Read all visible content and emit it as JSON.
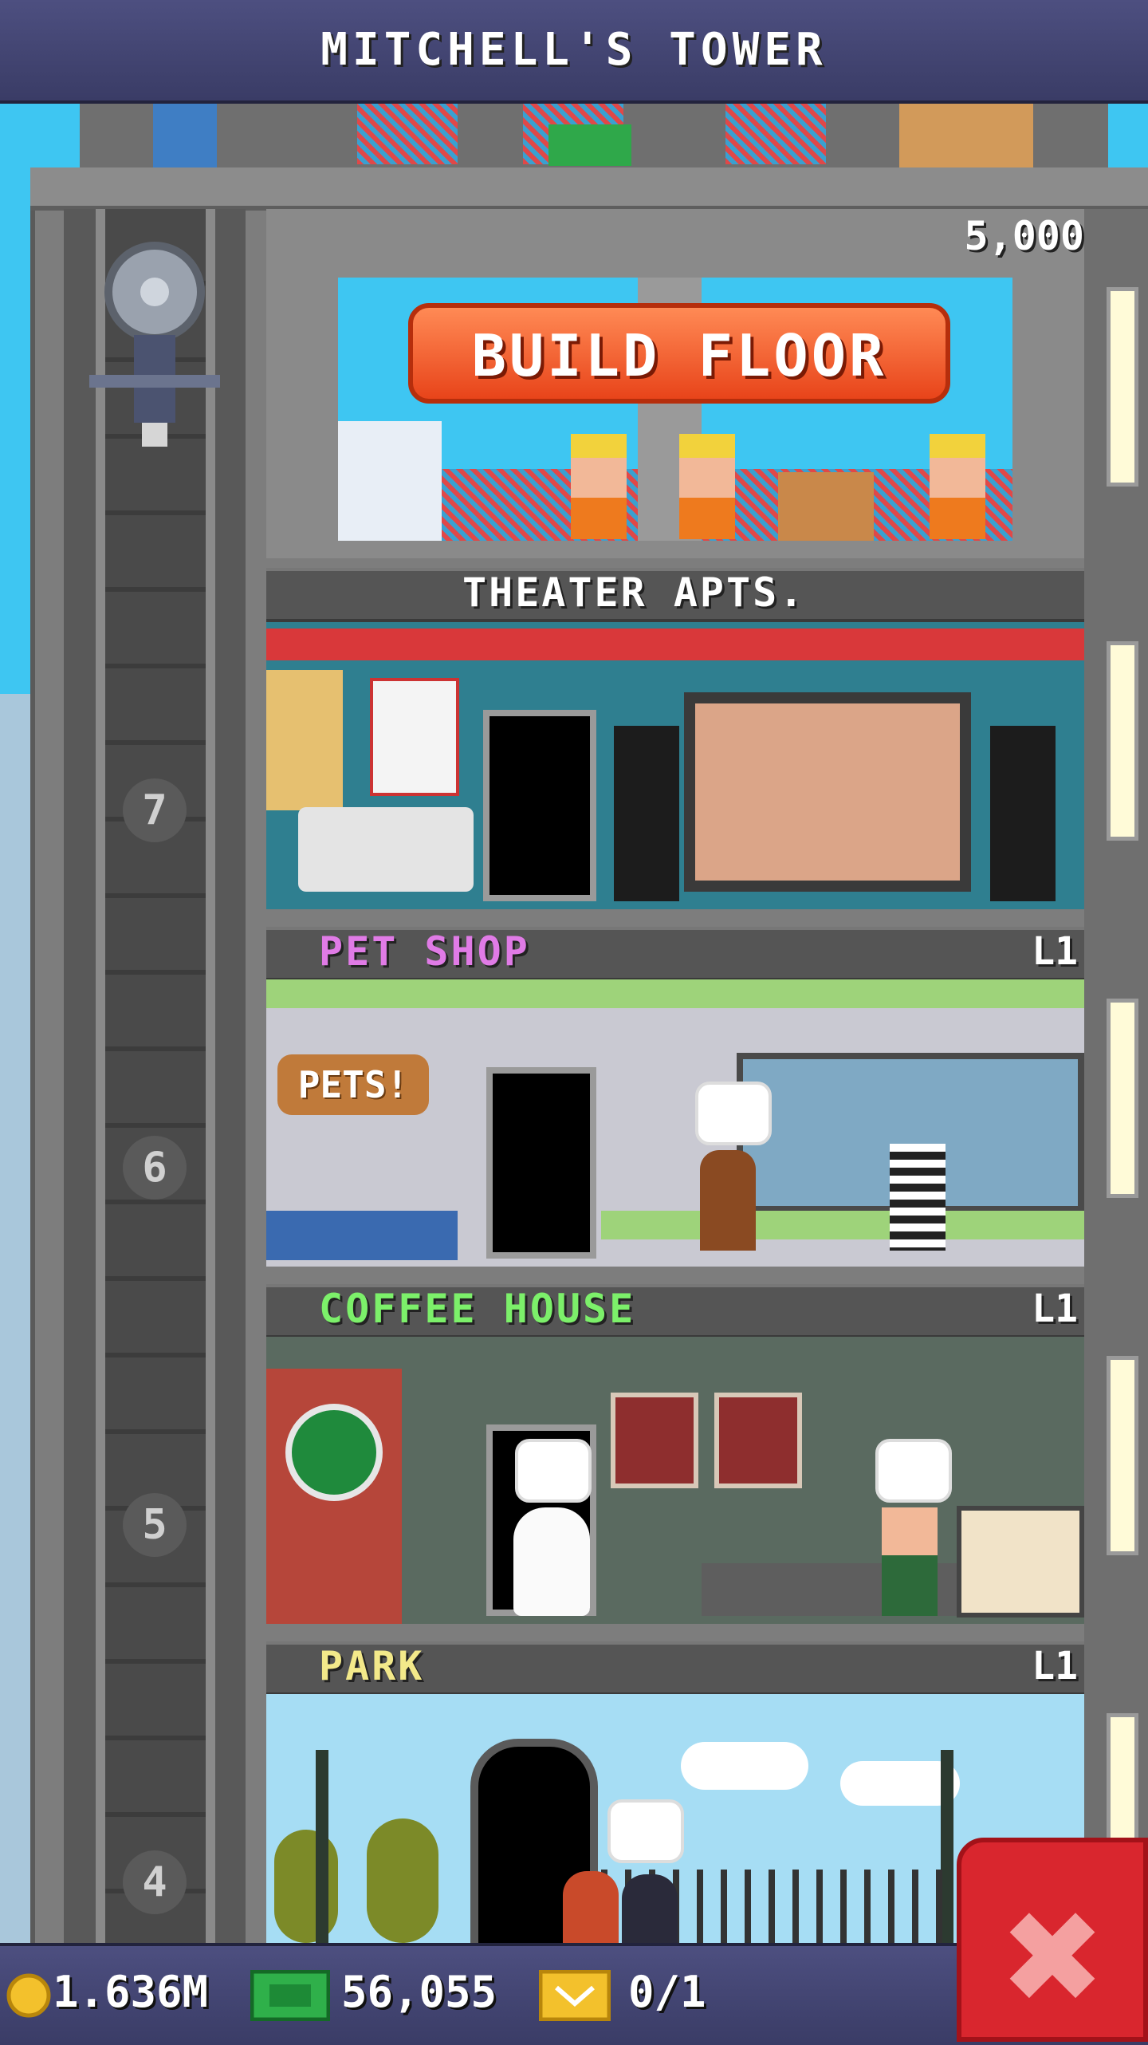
{
  "header": {
    "title": "MITCHELL'S TOWER"
  },
  "build": {
    "label": "BUILD FLOOR",
    "cost": "5,000"
  },
  "floors": [
    {
      "name": "THEATER APTS.",
      "level": "",
      "elevator_number": "7",
      "color": "#ffffff"
    },
    {
      "name": "PET SHOP",
      "level": "L1",
      "elevator_number": "6",
      "color": "#e07be6"
    },
    {
      "name": "COFFEE HOUSE",
      "level": "L1",
      "elevator_number": "5",
      "color": "#7cf06a"
    },
    {
      "name": "PARK",
      "level": "L1",
      "elevator_number": "4",
      "color": "#f3e98a"
    }
  ],
  "decor": {
    "pets_sign": "PETS!"
  },
  "resources": {
    "coins": "1.636M",
    "bux": "56,055",
    "tickets": "0/1"
  },
  "icons": {
    "coin": "coin-icon",
    "bux": "bux-icon",
    "ticket": "ticket-icon",
    "close": "close-icon"
  }
}
